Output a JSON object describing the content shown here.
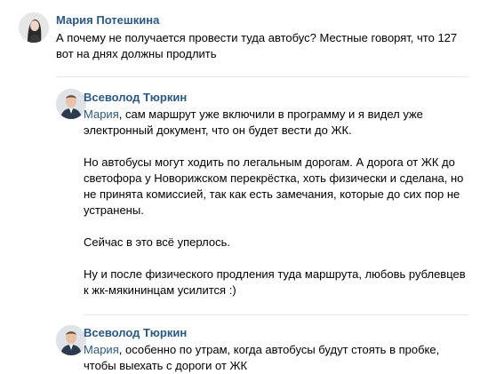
{
  "comments": [
    {
      "author": "Мария Потешкина",
      "avatar": "woman-portrait-avatar",
      "mention": "",
      "text": "А почему не получается провести туда автобус? Местные говорят, что 127\nвот на днях должны продлить"
    },
    {
      "author": "Всеволод Тюркин",
      "avatar": "man-portrait-avatar",
      "mention": "Мария",
      "text": ", сам маршрут уже включили в программу и я видел уже\nэлектронный документ, что он будет вести до ЖК.\n\nНо автобусы могут ходить по легальным дорогам. А дорога от ЖК до\nсветофора у Новорижском перекрёстка, хоть физически и сделана, но\nне принята комиссией, так как есть замечания, которые до сих пор не\nустранены.\n\nСейчас в это всё уперлось.\n\nНу и после физического продления туда маршрута, любовь рублевцев\nк жк-мякининцам усилится :)"
    },
    {
      "author": "Всеволод Тюркин",
      "avatar": "man-portrait-avatar",
      "mention": "Мария",
      "text": ", особенно по утрам, когда автобусы будут стоять в пробке,\nчтобы выехать с дороги от ЖК"
    }
  ]
}
